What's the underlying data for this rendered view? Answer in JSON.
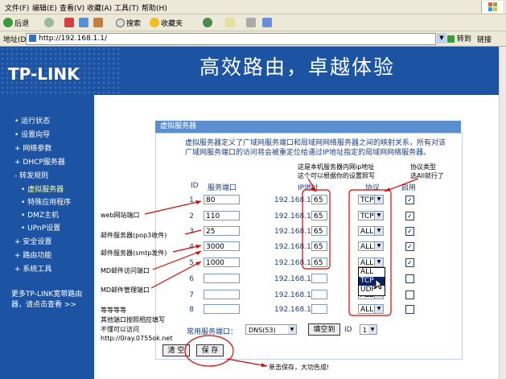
{
  "menubar": {
    "items": [
      "文件(F)",
      "编辑(E)",
      "查看(V)",
      "收藏(A)",
      "工具(T)",
      "帮助(H)"
    ]
  },
  "toolbar": {
    "back": "后退",
    "search": "搜索",
    "favorites": "收藏夹"
  },
  "address": {
    "label": "地址(D)",
    "url": "http://192.168.1.1/",
    "go": "转到",
    "links": "链接"
  },
  "banner": {
    "logo": "TP-LINK",
    "slogan": "高效路由，卓越体验"
  },
  "sidebar": {
    "items": [
      "• 运行状态",
      "• 设置向导",
      "+ 网络参数",
      "+ DHCP服务器",
      "- 转发规则",
      "• 虚拟服务器",
      "• 特殊应用程序",
      "• DMZ主机",
      "• UPnP设置",
      "+ 安全设置",
      "+ 路由功能",
      "+ 系统工具"
    ],
    "bottom": "更多TP-LINK宽带路由器，请点击查看 >>"
  },
  "panel": {
    "title": "虚拟服务器",
    "description": "虚拟服务器定义了广域网服务端口和局域网网络服务器之间的映射关系，所有对该广域网服务端口的访问将会被重定位给通过IP地址指定的局域网网络服务器。",
    "headers": {
      "id": "ID",
      "port": "服务端口",
      "ip": "IP地址",
      "protocol": "协议",
      "enable": "启用"
    },
    "ip_prefix": "192.168.1.",
    "rows": [
      {
        "id": "1",
        "port": "80",
        "ip": "65",
        "protocol": "TCP",
        "enabled": "✓"
      },
      {
        "id": "2",
        "port": "110",
        "ip": "65",
        "protocol": "TCP",
        "enabled": "✓"
      },
      {
        "id": "3",
        "port": "25",
        "ip": "65",
        "protocol": "ALL",
        "enabled": "✓"
      },
      {
        "id": "4",
        "port": "3000",
        "ip": "65",
        "protocol": "ALL",
        "enabled": "✓"
      },
      {
        "id": "5",
        "port": "1000",
        "ip": "65",
        "protocol": "ALL",
        "enabled": "✓"
      },
      {
        "id": "6",
        "port": "",
        "ip": "",
        "protocol": "",
        "enabled": ""
      },
      {
        "id": "7",
        "port": "",
        "ip": "",
        "protocol": "ALL",
        "enabled": ""
      },
      {
        "id": "8",
        "port": "",
        "ip": "",
        "protocol": "ALL",
        "enabled": ""
      }
    ],
    "protocol_options": [
      "ALL",
      "TCP",
      "UDP"
    ],
    "common_label": "常用服务端口：",
    "common_value": "DNS(53)",
    "fill_button": "填空到",
    "id_label": "ID",
    "id_value": "1",
    "clear_button": "清 空",
    "save_button": "保 存"
  },
  "annotations": {
    "a1": "这是本机服务器内网ip地址",
    "a2": "这个可以根据你的设置照写",
    "a3": "协议类型",
    "a4": "选All就行了",
    "web": "web网站端口",
    "pop3": "邮件服务器(pop3收件)",
    "smtp": "邮件服务器(smtp发件)",
    "mdaccess": "MD邮件访问端口",
    "mdmanage": "MD邮件管理端口",
    "etc1": "等等等等",
    "etc2": "其他端口按照相应填写",
    "etc3": "不懂可以访问",
    "etc4": "http://0ray.0755ok.net",
    "save": "单击保存，大功告成!"
  },
  "colors": {
    "banner": "#1c54a3",
    "panel_header": "#5b8fd0",
    "annotation": "#e00000"
  }
}
